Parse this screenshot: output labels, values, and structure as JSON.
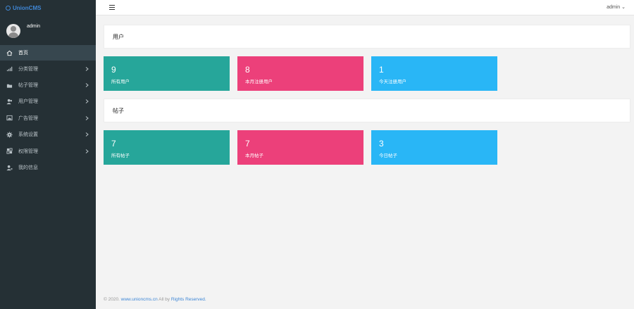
{
  "brand": {
    "name": "UnionCMS"
  },
  "user": {
    "name": "admin"
  },
  "sidebar": {
    "items": [
      {
        "label": "首页",
        "icon": "home-icon",
        "active": true,
        "has_children": false
      },
      {
        "label": "分类管理",
        "icon": "bar-chart-icon",
        "active": false,
        "has_children": true
      },
      {
        "label": "帖子管理",
        "icon": "folder-icon",
        "active": false,
        "has_children": true
      },
      {
        "label": "用户管理",
        "icon": "users-icon",
        "active": false,
        "has_children": true
      },
      {
        "label": "广告管理",
        "icon": "image-icon",
        "active": false,
        "has_children": true
      },
      {
        "label": "系统设置",
        "icon": "gear-icon",
        "active": false,
        "has_children": true
      },
      {
        "label": "权限管理",
        "icon": "permissions-icon",
        "active": false,
        "has_children": true
      },
      {
        "label": "我的信息",
        "icon": "profile-icon",
        "active": false,
        "has_children": false
      }
    ]
  },
  "topbar": {
    "admin_label": "admin ",
    "caret": "⌄"
  },
  "sections": [
    {
      "title": "用户",
      "cards": [
        {
          "value": "9",
          "label": "所有用户",
          "color": "#26a69a"
        },
        {
          "value": "8",
          "label": "本月注册用户",
          "color": "#ec407a"
        },
        {
          "value": "1",
          "label": "今天注册用户",
          "color": "#29b6f6"
        }
      ]
    },
    {
      "title": "帖子",
      "cards": [
        {
          "value": "7",
          "label": "所有帖子",
          "color": "#26a69a"
        },
        {
          "value": "7",
          "label": "本月帖子",
          "color": "#ec407a"
        },
        {
          "value": "3",
          "label": "今日帖子",
          "color": "#29b6f6"
        }
      ]
    }
  ],
  "footer": {
    "prefix": "© 2020. ",
    "link": "www.unioncms.cn",
    "middle": "  All by ",
    "rights": "Rights Reserved."
  }
}
